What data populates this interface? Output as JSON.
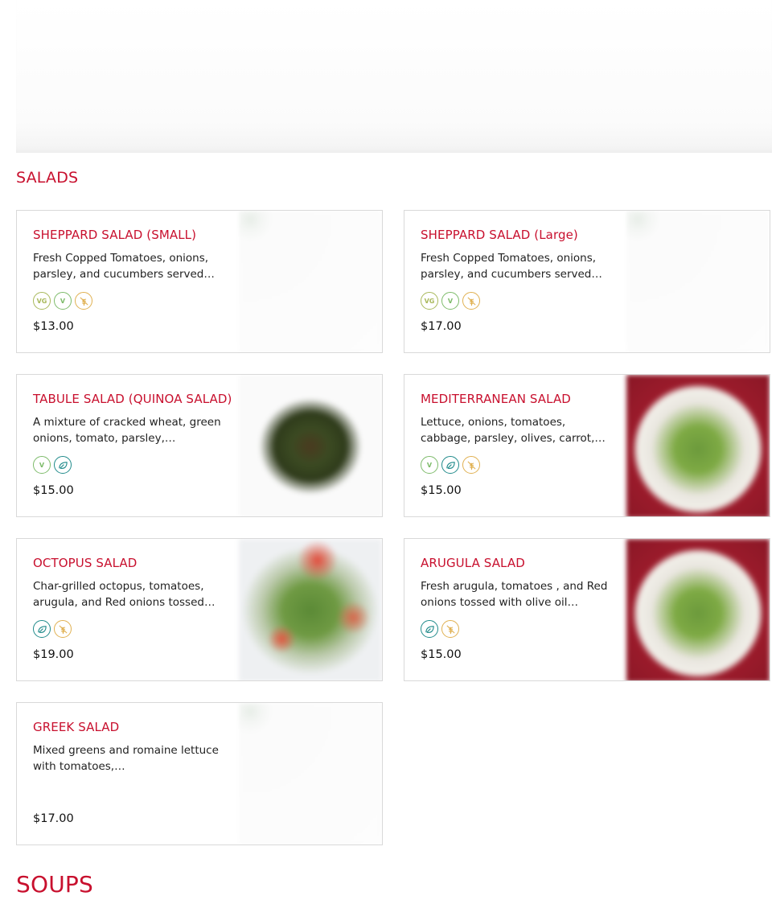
{
  "sections": {
    "salads_title": "SALADS",
    "soups_title": "SOUPS"
  },
  "colors": {
    "accent": "#c8102e",
    "tag_vg": "#a8b85a",
    "tag_v": "#7dbb6a",
    "tag_vegan": "#1f8a8a",
    "tag_gf": "#e0b050"
  },
  "tag_labels": {
    "vg": "VG",
    "v": "V"
  },
  "items": [
    {
      "name": "SHEPPARD SALAD (SMALL)",
      "description": "Fresh Copped Tomatoes, onions, parsley, and cucumbers served…",
      "tags": [
        "vg-icon",
        "vegetarian-icon",
        "gluten-free-icon"
      ],
      "price": "$13.00"
    },
    {
      "name": "SHEPPARD SALAD (Large)",
      "description": "Fresh Copped Tomatoes, onions, parsley, and cucumbers served…",
      "tags": [
        "vg-icon",
        "vegetarian-icon",
        "gluten-free-icon"
      ],
      "price": "$17.00"
    },
    {
      "name": "TABULE SALAD (QUINOA SALAD)",
      "description": "A mixture of cracked wheat, green onions, tomato, parsley,…",
      "tags": [
        "vegetarian-icon",
        "vegan-leaf-icon"
      ],
      "price": "$15.00"
    },
    {
      "name": "MEDITERRANEAN SALAD",
      "description": "Lettuce, onions, tomatoes, cabbage, parsley, olives, carrot,…",
      "tags": [
        "vegetarian-icon",
        "vegan-leaf-icon",
        "gluten-free-icon"
      ],
      "price": "$15.00"
    },
    {
      "name": "OCTOPUS SALAD",
      "description": "Char-grilled octopus, tomatoes, arugula, and Red onions tossed…",
      "tags": [
        "vegan-leaf-icon",
        "gluten-free-icon"
      ],
      "price": "$19.00"
    },
    {
      "name": "ARUGULA SALAD",
      "description": "Fresh arugula, tomatoes , and Red onions tossed with olive oil…",
      "tags": [
        "vegan-leaf-icon",
        "gluten-free-icon"
      ],
      "price": "$15.00"
    },
    {
      "name": "GREEK SALAD",
      "description": "Mixed greens and romaine lettuce with tomatoes,…",
      "tags": [],
      "price": "$17.00"
    }
  ]
}
